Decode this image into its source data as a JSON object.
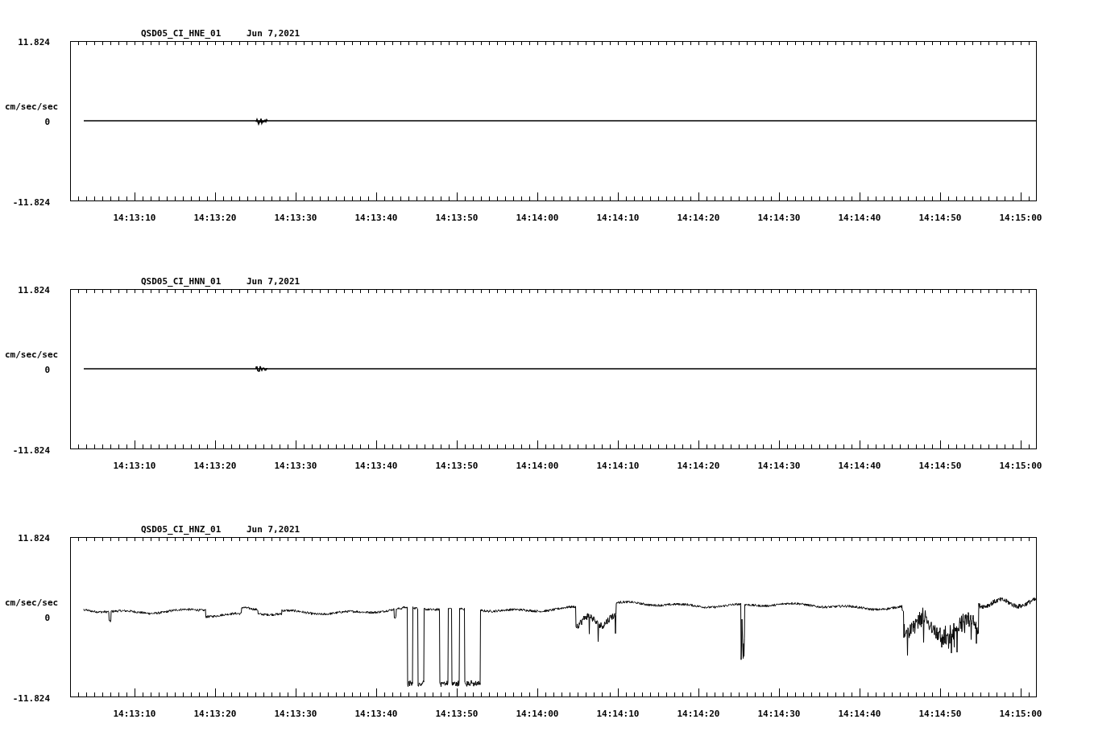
{
  "panels": [
    {
      "station": "QSD05_CI_HNE_01",
      "date": "Jun 7,2021",
      "y_max": "11.824",
      "y_unit": "cm/sec/sec",
      "y_zero": "0",
      "y_min": "-11.824",
      "trace": {
        "kind": "quiet"
      },
      "x_labels": [
        "14:13:10",
        "14:13:20",
        "14:13:30",
        "14:13:40",
        "14:13:50",
        "14:14:00",
        "14:14:10",
        "14:14:20",
        "14:14:30",
        "14:14:40",
        "14:14:50",
        "14:15:00"
      ]
    },
    {
      "station": "QSD05_CI_HNN_01",
      "date": "Jun 7,2021",
      "y_max": "11.824",
      "y_unit": "cm/sec/sec",
      "y_zero": "0",
      "y_min": "-11.824",
      "trace": {
        "kind": "quiet"
      },
      "x_labels": [
        "14:13:10",
        "14:13:20",
        "14:13:30",
        "14:13:40",
        "14:13:50",
        "14:14:00",
        "14:14:10",
        "14:14:20",
        "14:14:30",
        "14:14:40",
        "14:14:50",
        "14:15:00"
      ]
    },
    {
      "station": "QSD05_CI_HNZ_01",
      "date": "Jun 7,2021",
      "y_max": "11.824",
      "y_unit": "cm/sec/sec",
      "y_zero": "0",
      "y_min": "-11.824",
      "trace": {
        "kind": "noisy"
      },
      "x_labels": [
        "14:13:10",
        "14:13:20",
        "14:13:30",
        "14:13:40",
        "14:13:50",
        "14:14:00",
        "14:14:10",
        "14:14:20",
        "14:14:30",
        "14:14:40",
        "14:14:50",
        "14:15:00"
      ]
    }
  ]
}
